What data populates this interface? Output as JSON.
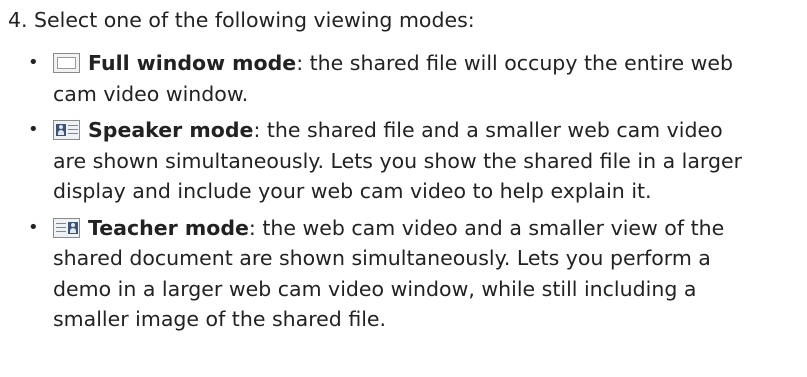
{
  "step": {
    "number": "4.",
    "text": "Select one of the following viewing modes:"
  },
  "modes": [
    {
      "icon": "full-window-mode-icon",
      "title": "Full window mode",
      "description": ": the shared file will occupy the entire web cam video window."
    },
    {
      "icon": "speaker-mode-icon",
      "title": "Speaker mode",
      "description": ": the shared file and a smaller web cam video are shown simultaneously. Lets you show the shared file in a larger display and include your web cam video to help explain it."
    },
    {
      "icon": "teacher-mode-icon",
      "title": "Teacher mode",
      "description": ": the web cam video and a smaller view of the shared document are shown simultaneously. Lets you perform a demo in a larger web cam video window, while still including a smaller image of the shared file."
    }
  ]
}
